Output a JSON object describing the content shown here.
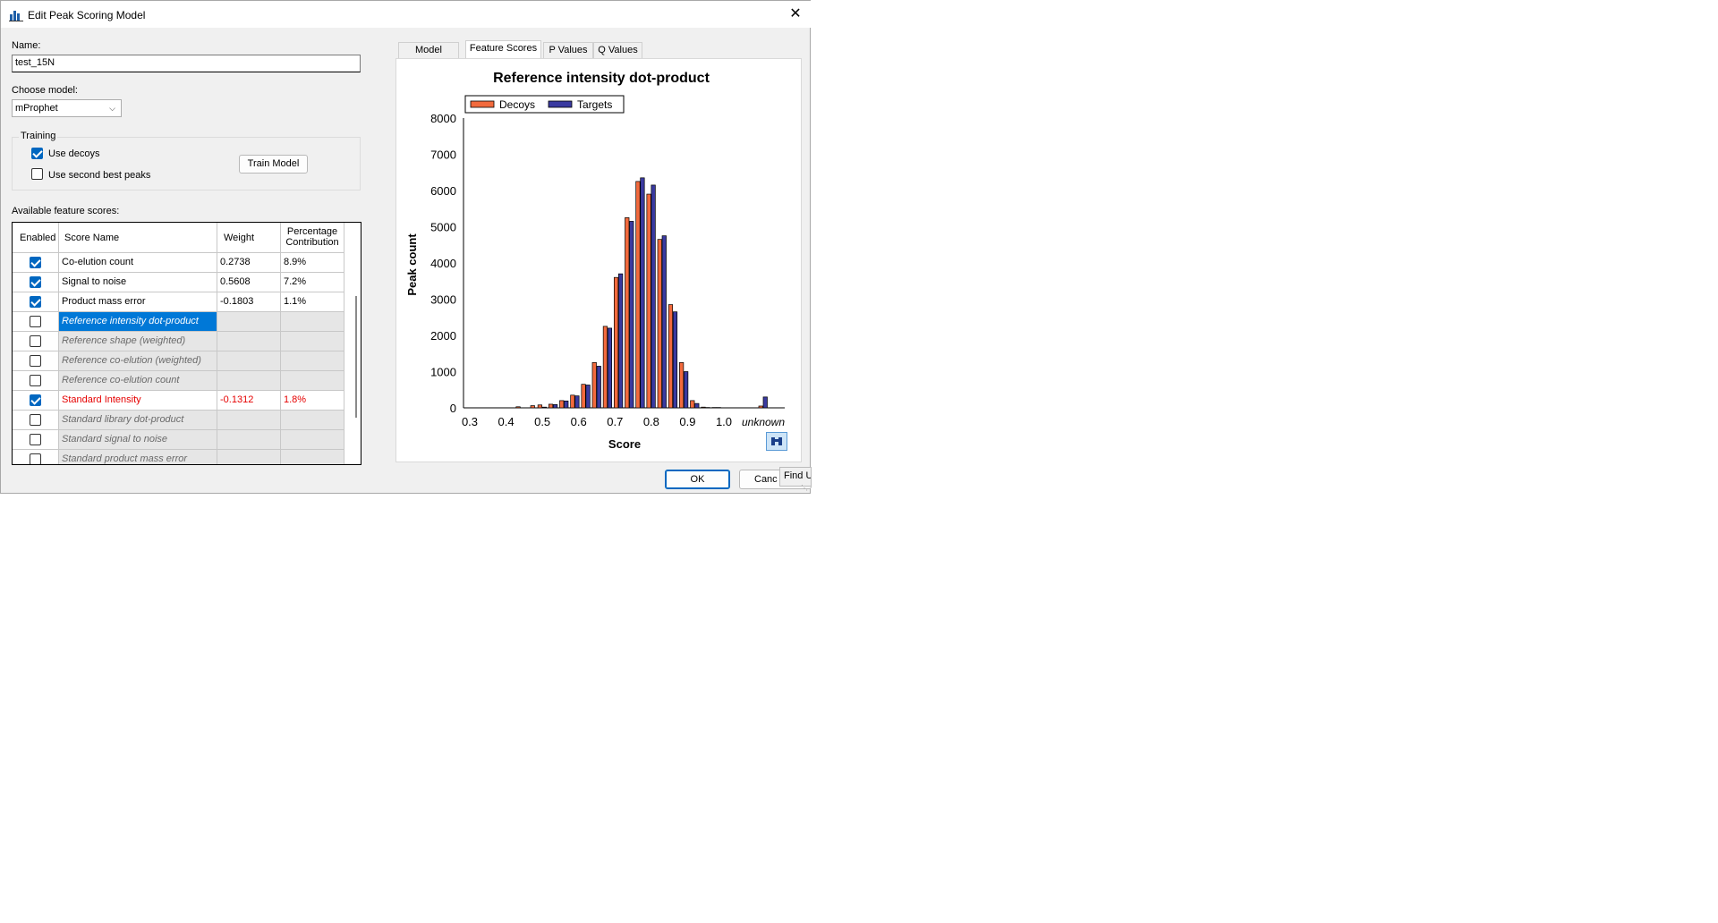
{
  "window": {
    "title": "Edit Peak Scoring Model",
    "close_glyph": "✕"
  },
  "name_field": {
    "label": "Name:",
    "value": "test_15N"
  },
  "model_field": {
    "label": "Choose model:",
    "value": "mProphet"
  },
  "training": {
    "legend": "Training",
    "use_decoys": {
      "label": "Use decoys",
      "checked": true
    },
    "use_second_best": {
      "label": "Use second best peaks",
      "checked": false
    },
    "train_button": "Train Model"
  },
  "features": {
    "label": "Available feature scores:",
    "columns": {
      "enabled": "Enabled",
      "name": "Score Name",
      "weight": "Weight",
      "contribution_1": "Percentage",
      "contribution_2": "Contribution"
    },
    "rows": [
      {
        "enabled": true,
        "name": "Co-elution count",
        "weight": "0.2738",
        "contribution": "8.9%",
        "style": "normal"
      },
      {
        "enabled": true,
        "name": "Signal to noise",
        "weight": "0.5608",
        "contribution": "7.2%",
        "style": "normal"
      },
      {
        "enabled": true,
        "name": "Product mass error",
        "weight": "-0.1803",
        "contribution": "1.1%",
        "style": "normal"
      },
      {
        "enabled": false,
        "name": "Reference intensity dot-product",
        "weight": "",
        "contribution": "",
        "style": "selected"
      },
      {
        "enabled": false,
        "name": "Reference shape (weighted)",
        "weight": "",
        "contribution": "",
        "style": "disabled"
      },
      {
        "enabled": false,
        "name": "Reference co-elution (weighted)",
        "weight": "",
        "contribution": "",
        "style": "disabled"
      },
      {
        "enabled": false,
        "name": "Reference co-elution count",
        "weight": "",
        "contribution": "",
        "style": "disabled"
      },
      {
        "enabled": true,
        "name": "Standard Intensity",
        "weight": "-0.1312",
        "contribution": "1.8%",
        "style": "red"
      },
      {
        "enabled": false,
        "name": "Standard library dot-product",
        "weight": "",
        "contribution": "",
        "style": "disabled"
      },
      {
        "enabled": false,
        "name": "Standard signal to noise",
        "weight": "",
        "contribution": "",
        "style": "disabled"
      },
      {
        "enabled": false,
        "name": "Standard product mass error",
        "weight": "",
        "contribution": "",
        "style": "disabled"
      }
    ]
  },
  "tabs": [
    "Model Scores",
    "Feature Scores",
    "P Values",
    "Q Values"
  ],
  "active_tab": 1,
  "buttons": {
    "ok": "OK",
    "cancel": "Canc",
    "find": "Find Ur"
  },
  "colors": {
    "decoy_fill": "#f26a3d",
    "target_fill": "#3a3aa0",
    "selection": "#0078d7",
    "red_text": "#e60000"
  },
  "chart_data": {
    "type": "bar",
    "title": "Reference intensity dot-product",
    "xlabel": "Score",
    "ylabel": "Peak count",
    "ylim": [
      0,
      8000
    ],
    "yticks": [
      0,
      1000,
      2000,
      3000,
      4000,
      5000,
      6000,
      7000,
      8000
    ],
    "xticks": [
      "0.3",
      "0.4",
      "0.5",
      "0.6",
      "0.7",
      "0.8",
      "0.9",
      "1.0",
      "unknown"
    ],
    "legend_position": "top-left",
    "grid": false,
    "categories": [
      "0.44",
      "0.48",
      "0.50",
      "0.53",
      "0.56",
      "0.59",
      "0.62",
      "0.65",
      "0.68",
      "0.71",
      "0.74",
      "0.77",
      "0.80",
      "0.83",
      "0.86",
      "0.89",
      "0.92",
      "0.95",
      "0.98",
      "unknown"
    ],
    "series": [
      {
        "name": "Decoys",
        "values": [
          30,
          60,
          80,
          100,
          200,
          350,
          650,
          1250,
          2250,
          3600,
          5250,
          6250,
          5900,
          4650,
          2850,
          1250,
          200,
          20,
          10,
          50
        ]
      },
      {
        "name": "Targets",
        "values": [
          0,
          0,
          20,
          90,
          190,
          330,
          630,
          1150,
          2200,
          3700,
          5150,
          6350,
          6150,
          4750,
          2650,
          1000,
          120,
          10,
          10,
          300
        ]
      }
    ]
  }
}
